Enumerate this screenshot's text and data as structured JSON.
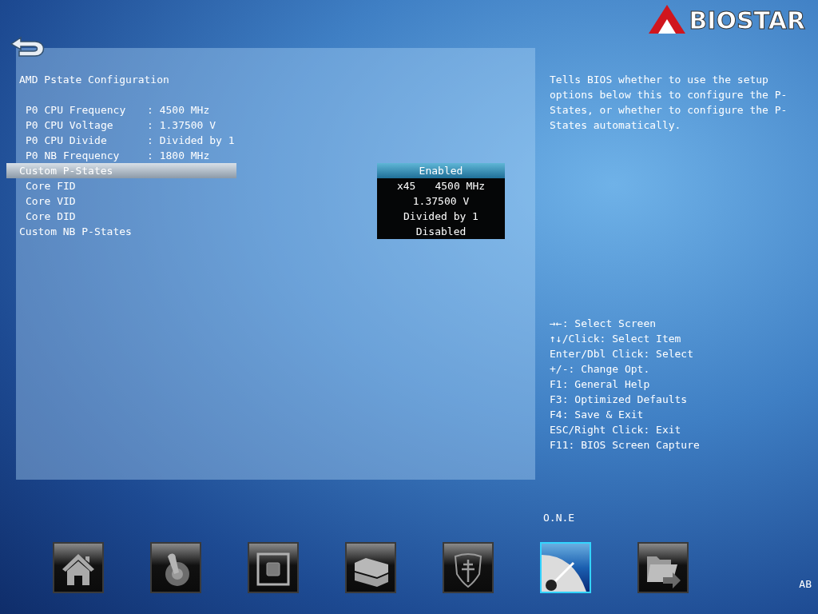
{
  "header": {
    "logo": "BIOSTAR"
  },
  "panel": {
    "title": "AMD Pstate Configuration",
    "info": [
      {
        "label": "P0 CPU Frequency",
        "value": ": 4500 MHz"
      },
      {
        "label": "P0 CPU Voltage",
        "value": ": 1.37500 V"
      },
      {
        "label": "P0 CPU Divide",
        "value": ": Divided by 1"
      },
      {
        "label": "P0 NB Frequency",
        "value": ": 1800 MHz"
      }
    ],
    "items": [
      {
        "label": "Custom P-States",
        "values": [
          "Enabled"
        ],
        "selected": true,
        "children": [
          {
            "label": "Core FID",
            "values": [
              "x45",
              "4500 MHz"
            ],
            "selected": false
          },
          {
            "label": "Core VID",
            "values": [
              "1.37500 V"
            ],
            "selected": false
          },
          {
            "label": "Core DID",
            "values": [
              "Divided by 1"
            ],
            "selected": false
          }
        ]
      },
      {
        "label": "Custom NB P-States",
        "values": [
          "Disabled"
        ],
        "selected": false
      }
    ]
  },
  "help": "Tells BIOS whether to use the setup options below this to configure the P-States, or whether to configure the P-States automatically.",
  "key_hints": [
    "→←: Select Screen",
    "↑↓/Click: Select Item",
    "Enter/Dbl Click: Select",
    "+/-: Change Opt.",
    "F1: General Help",
    "F3: Optimized Defaults",
    "F4: Save & Exit",
    "ESC/Right Click: Exit",
    "F11: BIOS Screen Capture"
  ],
  "nav": [
    {
      "kind": "home",
      "selected": false
    },
    {
      "kind": "switch",
      "selected": false
    },
    {
      "kind": "chip",
      "selected": false
    },
    {
      "kind": "drives",
      "selected": false
    },
    {
      "kind": "shield",
      "selected": false
    },
    {
      "kind": "gauge",
      "selected": true,
      "label": "O.N.E"
    },
    {
      "kind": "folder",
      "selected": false
    }
  ],
  "corner_text": "AB"
}
